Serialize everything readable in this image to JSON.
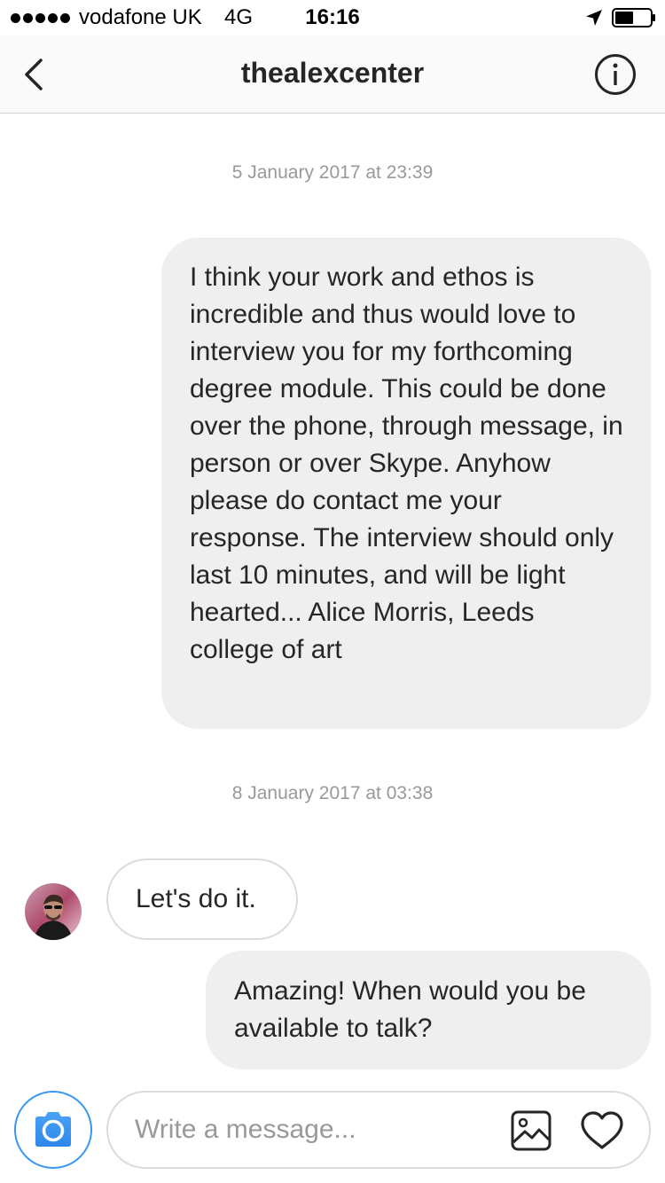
{
  "status_bar": {
    "carrier": "vodafone UK",
    "network": "4G",
    "time": "16:16"
  },
  "header": {
    "title": "thealexcenter",
    "back_icon": "chevron-left-icon",
    "info_icon": "info-icon"
  },
  "messages": [
    {
      "type": "timestamp",
      "text": "5 January 2017 at 23:39"
    },
    {
      "type": "sent",
      "text": "I think your work and ethos is incredible and thus would love to interview you for my forthcoming degree module. This could be done over the phone, through message, in person or over Skype. Anyhow please do contact me your response. The interview should only last 10 minutes, and will be light hearted... Alice Morris, Leeds college of art"
    },
    {
      "type": "timestamp",
      "text": "8 January 2017 at 03:38"
    },
    {
      "type": "received",
      "text": "Let's do it."
    },
    {
      "type": "sent",
      "text": "Amazing! When would you be available to talk?"
    }
  ],
  "composer": {
    "placeholder": "Write a message...",
    "value": "",
    "camera_icon": "camera-icon",
    "gallery_icon": "gallery-icon",
    "heart_icon": "heart-icon"
  },
  "colors": {
    "accent": "#3897f0",
    "sent_bubble": "#efefef",
    "received_border": "#dbdbdb",
    "timestamp": "#999999"
  }
}
